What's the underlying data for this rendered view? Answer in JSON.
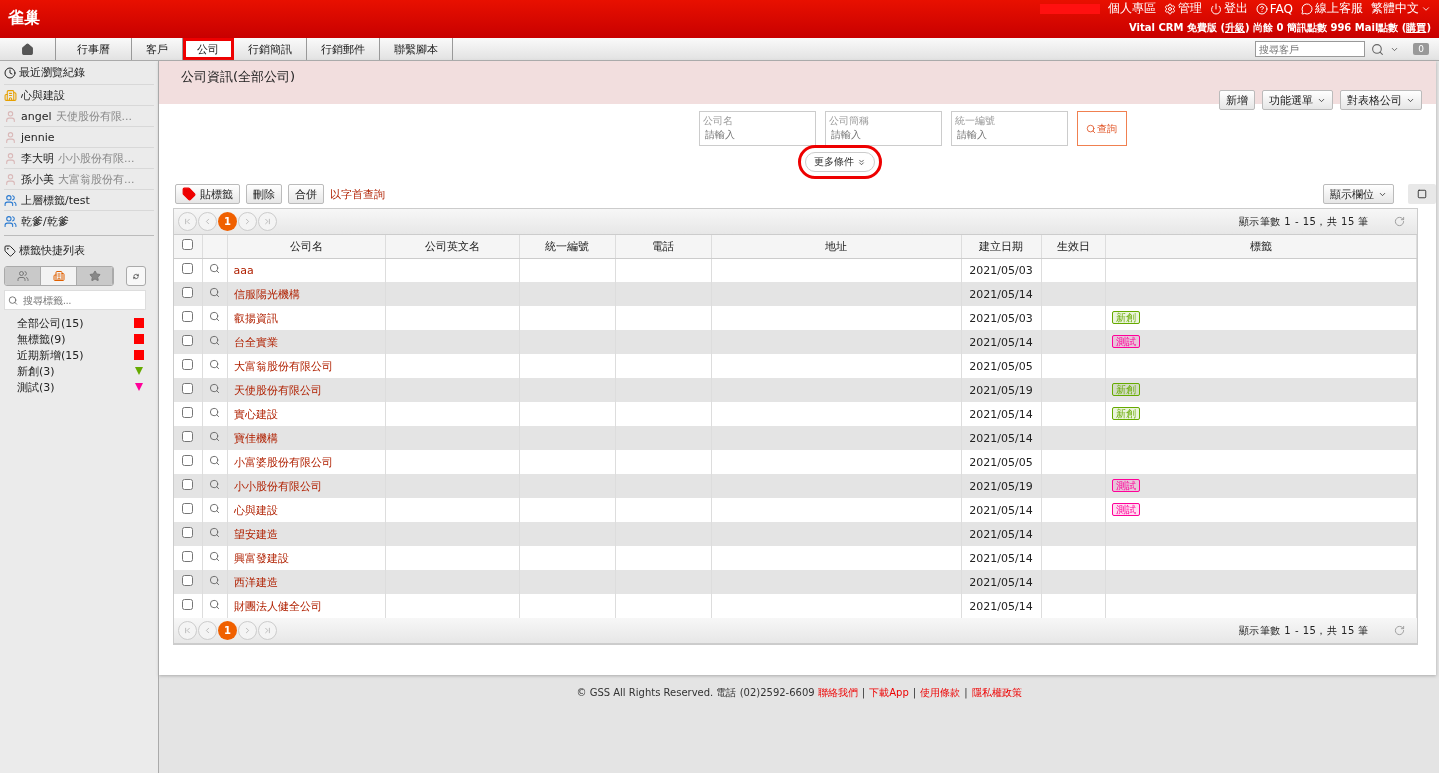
{
  "header": {
    "logo": "雀巢",
    "links": [
      {
        "kind": "user",
        "label": "個人專區"
      },
      {
        "kind": "gear",
        "label": "管理"
      },
      {
        "kind": "power",
        "label": "登出"
      },
      {
        "kind": "help",
        "label": "FAQ"
      },
      {
        "kind": "chat",
        "label": "線上客服"
      }
    ],
    "language": "繁體中文",
    "plan": "Vital CRM 免費版 (",
    "upgrade": "升級",
    "plan_end": ")",
    "balance": "尚餘 0 簡訊點數 996 Mail點數 (",
    "buy": "購買",
    "balance_end": ")"
  },
  "tabs": [
    {
      "label": "行事曆",
      "selected": false,
      "highlighted": false
    },
    {
      "label": "客戶",
      "selected": false,
      "highlighted": false
    },
    {
      "label": "公司",
      "selected": true,
      "highlighted": true
    },
    {
      "label": "行銷簡訊",
      "selected": false,
      "highlighted": false
    },
    {
      "label": "行銷郵件",
      "selected": false,
      "highlighted": false
    },
    {
      "label": "聯繫腳本",
      "selected": false,
      "highlighted": false
    }
  ],
  "customer_search": {
    "placeholder": "搜尋客戶"
  },
  "notification_count": "0",
  "sidebar": {
    "recent_title": "最近瀏覽紀錄",
    "recent": [
      {
        "kind": "company",
        "name": "心與建設"
      },
      {
        "kind": "person",
        "name": "angel",
        "sub": "天使股份有限..."
      },
      {
        "kind": "person",
        "name": "jennie"
      },
      {
        "kind": "person",
        "name": "李大明",
        "sub": "小小股份有限..."
      },
      {
        "kind": "person",
        "name": "孫小美",
        "sub": "大富翁股份有..."
      },
      {
        "kind": "tag",
        "name": "上層標籤/test"
      },
      {
        "kind": "tag",
        "name": "乾爹/乾爹"
      }
    ],
    "tags_title": "標籤快捷列表",
    "tag_tabs": [
      {
        "kind": "people",
        "selected": false
      },
      {
        "kind": "company",
        "selected": true
      },
      {
        "kind": "star",
        "selected": false
      }
    ],
    "tag_search": {
      "placeholder": "搜尋標籤..."
    },
    "tags": [
      {
        "label": "全部公司(15)",
        "kind": "square",
        "color": "#ff0000"
      },
      {
        "label": "無標籤(9)",
        "kind": "square",
        "color": "#ff0000"
      },
      {
        "label": "近期新增(15)",
        "kind": "square",
        "color": "#ff0000"
      },
      {
        "label": "新創(3)",
        "kind": "triangle",
        "color": "#66aa00"
      },
      {
        "label": "測試(3)",
        "kind": "triangle",
        "color": "#ff0099"
      }
    ]
  },
  "page_title": "公司資訊(全部公司)",
  "actions": [
    "新增",
    "功能選單",
    "對表格公司"
  ],
  "filters": [
    {
      "label": "公司名",
      "placeholder": "請輸入"
    },
    {
      "label": "公司簡稱",
      "placeholder": "請輸入"
    },
    {
      "label": "統一編號",
      "placeholder": "請輸入"
    }
  ],
  "query_button": "查詢",
  "more_button": {
    "label": "更多條件",
    "highlighted": true
  },
  "toolbar": [
    "貼標籤",
    "刪除",
    "合併"
  ],
  "initial_query": "以字首查詢",
  "columns_button": "顯示欄位",
  "pagers": [
    {
      "page": "1",
      "summary": "顯示筆數 1 - 15，共 15 筆"
    },
    {
      "page": "1",
      "summary": "顯示筆數 1 - 15，共 15 筆"
    }
  ],
  "select_all_checked": false,
  "table": {
    "columns": [
      "公司名",
      "公司英文名",
      "統一編號",
      "電話",
      "地址",
      "建立日期",
      "生效日",
      "標籤"
    ],
    "rows": [
      {
        "checked": false,
        "name": "aaa",
        "created": "2021/05/03",
        "tags": []
      },
      {
        "checked": false,
        "name": "信服陽光機構",
        "created": "2021/05/14",
        "tags": []
      },
      {
        "checked": false,
        "name": "叡揚資訊",
        "created": "2021/05/03",
        "tags": [
          {
            "label": "新創",
            "color": "#66aa00"
          }
        ]
      },
      {
        "checked": false,
        "name": "台全實業",
        "created": "2021/05/14",
        "tags": [
          {
            "label": "測試",
            "color": "#ff0099"
          }
        ]
      },
      {
        "checked": false,
        "name": "大富翁股份有限公司",
        "created": "2021/05/05",
        "tags": []
      },
      {
        "checked": false,
        "name": "天使股份有限公司",
        "created": "2021/05/19",
        "tags": [
          {
            "label": "新創",
            "color": "#66aa00"
          }
        ]
      },
      {
        "checked": false,
        "name": "實心建設",
        "created": "2021/05/14",
        "tags": [
          {
            "label": "新創",
            "color": "#66aa00"
          }
        ]
      },
      {
        "checked": false,
        "name": "寶佳機構",
        "created": "2021/05/14",
        "tags": []
      },
      {
        "checked": false,
        "name": "小富婆股份有限公司",
        "created": "2021/05/05",
        "tags": []
      },
      {
        "checked": false,
        "name": "小小股份有限公司",
        "created": "2021/05/19",
        "tags": [
          {
            "label": "測試",
            "color": "#ff0099"
          }
        ]
      },
      {
        "checked": false,
        "name": "心與建設",
        "created": "2021/05/14",
        "tags": [
          {
            "label": "測試",
            "color": "#ff0099"
          }
        ]
      },
      {
        "checked": false,
        "name": "望安建造",
        "created": "2021/05/14",
        "tags": []
      },
      {
        "checked": false,
        "name": "興富發建設",
        "created": "2021/05/14",
        "tags": []
      },
      {
        "checked": false,
        "name": "西洋建造",
        "created": "2021/05/14",
        "tags": []
      },
      {
        "checked": false,
        "name": "財團法人健全公司",
        "created": "2021/05/14",
        "tags": []
      }
    ]
  },
  "footer": {
    "text": "© GSS All Rights Reserved. 電話 (02)2592-6609",
    "items": [
      {
        "kind": "link",
        "label": "聯絡我們"
      },
      {
        "kind": "separator",
        "label": "|"
      },
      {
        "kind": "link",
        "label": "下載App"
      },
      {
        "kind": "separator",
        "label": "|"
      },
      {
        "kind": "link",
        "label": "使用條款"
      },
      {
        "kind": "separator",
        "label": "|"
      },
      {
        "kind": "link",
        "label": "隱私權政策"
      }
    ]
  }
}
